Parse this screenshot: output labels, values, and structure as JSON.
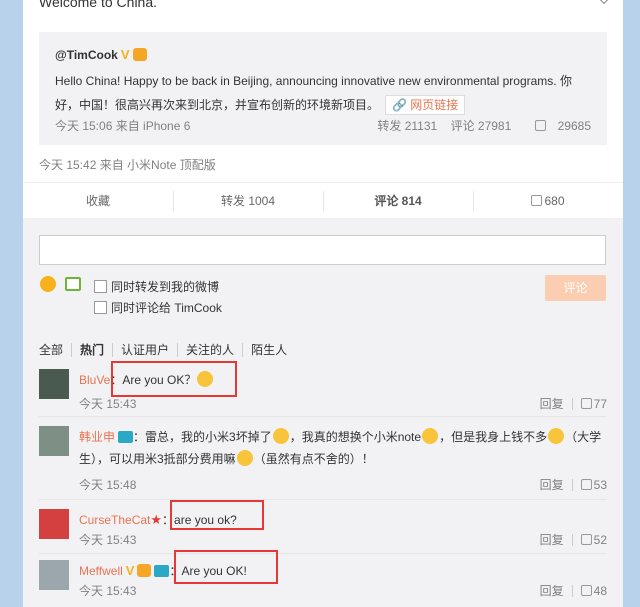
{
  "post": {
    "text": "Welcome to China."
  },
  "quote": {
    "author": "@TimCook",
    "v_badge": "V",
    "body": "Hello China! Happy to be back in Beijing, announcing innovative new environmental programs. 你好，中国！很高兴再次来到北京，并宣布创新的环境新项目。",
    "link_label": "网页链接",
    "time": "今天 15:06 来自 iPhone 6",
    "reposts": "转发 21131",
    "comments": "评论 27981",
    "likes": "29685"
  },
  "post_time": "今天 15:42 来自 小米Note 顶配版",
  "tabs": {
    "fav": "收藏",
    "repost": "转发 1004",
    "comment": "评论 814",
    "like": "680"
  },
  "composer": {
    "check1": "同时转发到我的微博",
    "check2": "同时评论给 TimCook",
    "submit": "评论"
  },
  "filters": [
    "全部",
    "热门",
    "认证用户",
    "关注的人",
    "陌生人"
  ],
  "comments": [
    {
      "user": "BluVe",
      "text": "：Are you OK？",
      "time": "今天 15:43",
      "reply": "回复",
      "likes": "77"
    },
    {
      "user": "韩业申",
      "text_a": "：雷总，我的小米3坏掉了",
      "text_b": "，我真的想换个小米note",
      "text_c": "，但是我身上钱不多",
      "text_d": "（大学生），可以用米3抵部分费用嘛",
      "text_e": "（虽然有点不舍的）！",
      "time": "今天 15:48",
      "reply": "回复",
      "likes": "53"
    },
    {
      "user": "CurseTheCat",
      "text": "：are you ok?",
      "time": "今天 15:43",
      "reply": "回复",
      "likes": "52"
    },
    {
      "user": "Meffwell",
      "v_badge": "V",
      "text": "：Are you OK!",
      "time": "今天 15:43",
      "reply": "回复",
      "likes": "48"
    }
  ],
  "colors": {
    "link": "#eb7350",
    "highlight_box": "#e53935",
    "background": "#b7d2ea"
  }
}
